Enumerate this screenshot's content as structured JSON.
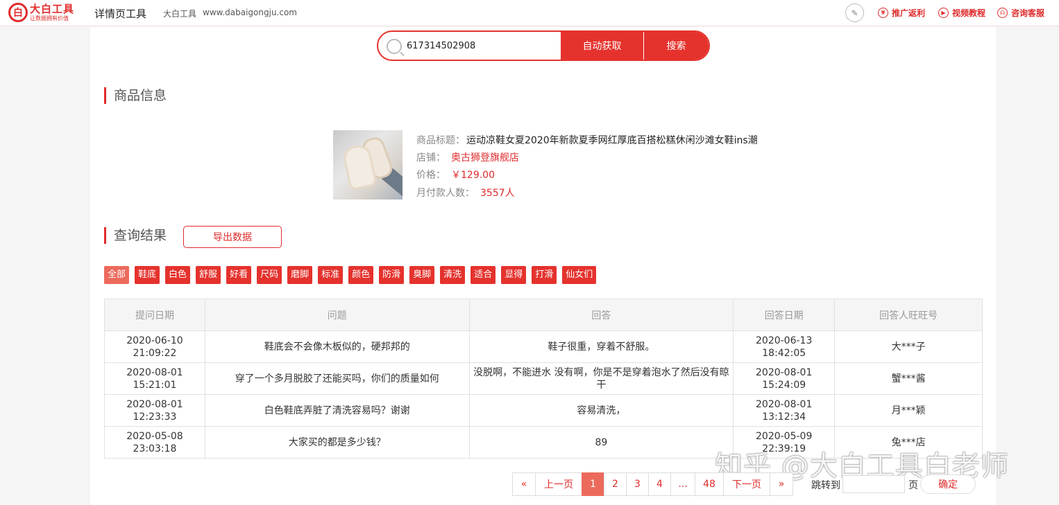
{
  "header": {
    "logo_mark": "白",
    "logo_name": "大白工具",
    "logo_slogan": "让数据拥有价值",
    "app_title": "详情页工具",
    "site_name": "大白工具",
    "site_url": "www.dabaigongju.com",
    "nav": [
      {
        "label": "推广返利",
        "icon": "yen-icon"
      },
      {
        "label": "视频教程",
        "icon": "play-icon"
      },
      {
        "label": "咨询客服",
        "icon": "headset-icon"
      }
    ]
  },
  "search": {
    "value": "617314502908",
    "auto_fetch_label": "自动获取",
    "search_label": "搜索"
  },
  "product_section": {
    "title": "商品信息",
    "title_label": "商品标题：",
    "title_value": "运动凉鞋女夏2020年新款夏季网红厚底百搭松糕休闲沙滩女鞋ins潮",
    "shop_label": "店铺：",
    "shop_value": "奥古狮登旗舰店",
    "price_label": "价格：",
    "price_value": "￥129.00",
    "buyers_label": "月付款人数：",
    "buyers_value": "3557人"
  },
  "results_section": {
    "title": "查询结果",
    "export_label": "导出数据",
    "tags": [
      "全部",
      "鞋底",
      "白色",
      "舒服",
      "好看",
      "尺码",
      "磨脚",
      "标准",
      "颜色",
      "防滑",
      "臭脚",
      "清洗",
      "适合",
      "显得",
      "打滑",
      "仙女们"
    ]
  },
  "table": {
    "headers": [
      "提问日期",
      "问题",
      "回答",
      "回答日期",
      "回答人旺旺号"
    ],
    "rows": [
      [
        "2020-06-10 21:09:22",
        "鞋底会不会像木板似的，硬邦邦的",
        "鞋子很重，穿着不舒服。",
        "2020-06-13 18:42:05",
        "大***子"
      ],
      [
        "2020-08-01 15:21:01",
        "穿了一个多月脱胶了还能买吗，你们的质量如何",
        "没脱啊，不能进水 没有啊，你是不是穿着泡水了然后没有晾干",
        "2020-08-01 15:24:09",
        "蟹***酱"
      ],
      [
        "2020-08-01 12:23:33",
        "白色鞋底弄脏了清洗容易吗？谢谢",
        "容易清洗，",
        "2020-08-01 13:12:34",
        "月***颖"
      ],
      [
        "2020-05-08 23:03:18",
        "大家买的都是多少钱？",
        "89",
        "2020-05-09 22:39:19",
        "兔***店"
      ]
    ]
  },
  "pagination": {
    "first": "«",
    "prev": "上一页",
    "pages": [
      "1",
      "2",
      "3",
      "4",
      "...",
      "48"
    ],
    "current": "1",
    "next": "下一页",
    "last": "»",
    "jump_label": "跳转到",
    "jump_unit": "页",
    "confirm_label": "确定"
  },
  "watermark": "知乎 @大白工具白老师",
  "colors": {
    "accent": "#e5322d",
    "tag_active": "#ec6a5c"
  }
}
